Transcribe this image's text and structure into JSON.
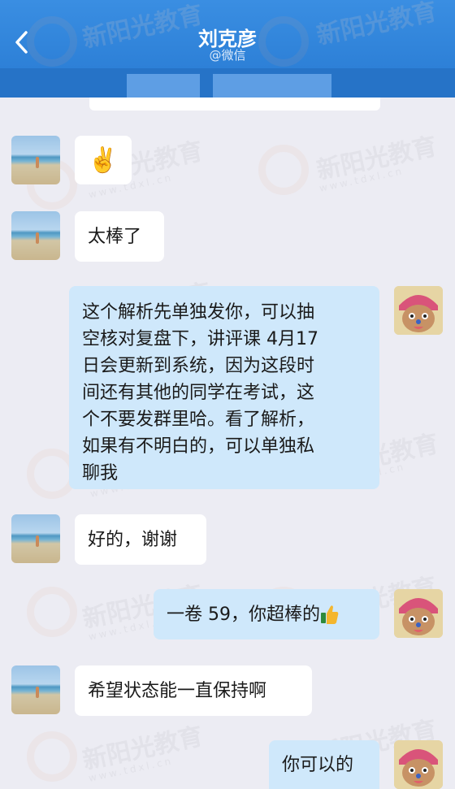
{
  "header": {
    "back_icon": "chevron-left-icon",
    "title": "刘克彦",
    "subtitle": "@微信"
  },
  "watermark": {
    "text": "新阳光教育",
    "url": "www.tdxl.cn"
  },
  "messages": [
    {
      "side": "left",
      "avatar": "beach-avatar",
      "text": "✌️"
    },
    {
      "side": "left",
      "avatar": "beach-avatar",
      "text": "太棒了"
    },
    {
      "side": "right",
      "avatar": "chopper-avatar",
      "lines": [
        "这个解析先单独发你，可以抽",
        "空核对复盘下，讲评课 4月17",
        "日会更新到系统，因为这段时",
        "间还有其他的同学在考试，这",
        "个不要发群里哈。看了解析，",
        "如果有不明白的，可以单独私",
        "聊我"
      ]
    },
    {
      "side": "left",
      "avatar": "beach-avatar",
      "text": "好的，谢谢"
    },
    {
      "side": "right",
      "avatar": "chopper-avatar",
      "text": "一卷 59，你超棒的",
      "emoji": "thumbs-up-icon"
    },
    {
      "side": "left",
      "avatar": "beach-avatar",
      "text": "希望状态能一直保持啊"
    },
    {
      "side": "right",
      "avatar": "chopper-avatar",
      "text": "你可以的"
    }
  ],
  "colors": {
    "header": "#2c7fd6",
    "background": "#ececf3",
    "outgoing_bubble": "#cfe8fb",
    "incoming_bubble": "#ffffff"
  }
}
